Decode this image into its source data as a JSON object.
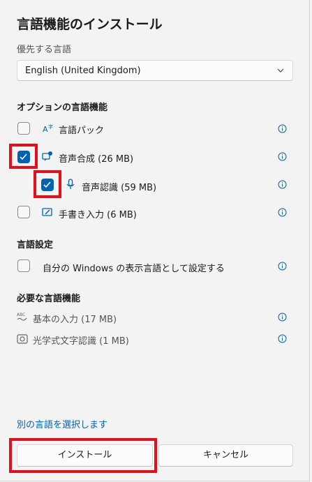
{
  "dialog": {
    "title": "言語機能のインストール",
    "preferred_label": "優先する言語",
    "preferred_value": "English (United Kingdom)"
  },
  "optional_features": {
    "heading": "オプションの言語機能",
    "items": [
      {
        "label": "言語パック",
        "checked": false
      },
      {
        "label": "音声合成 (26 MB)",
        "checked": true
      },
      {
        "label": "音声認識 (59 MB)",
        "checked": true
      },
      {
        "label": "手書き入力 (6 MB)",
        "checked": false
      }
    ]
  },
  "language_settings": {
    "heading": "言語設定",
    "items": [
      {
        "label": "自分の Windows の表示言語として設定する",
        "checked": false
      }
    ]
  },
  "required_features": {
    "heading": "必要な言語機能",
    "items": [
      {
        "label": "基本の入力 (17 MB)"
      },
      {
        "label": "光学式文字認識 (1 MB)"
      }
    ]
  },
  "footer": {
    "link": "別の言語を選択します",
    "install": "インストール",
    "cancel": "キャンセル"
  },
  "colors": {
    "accent": "#0063b1",
    "highlight": "#e3101b",
    "background": "#f3f3f3"
  }
}
